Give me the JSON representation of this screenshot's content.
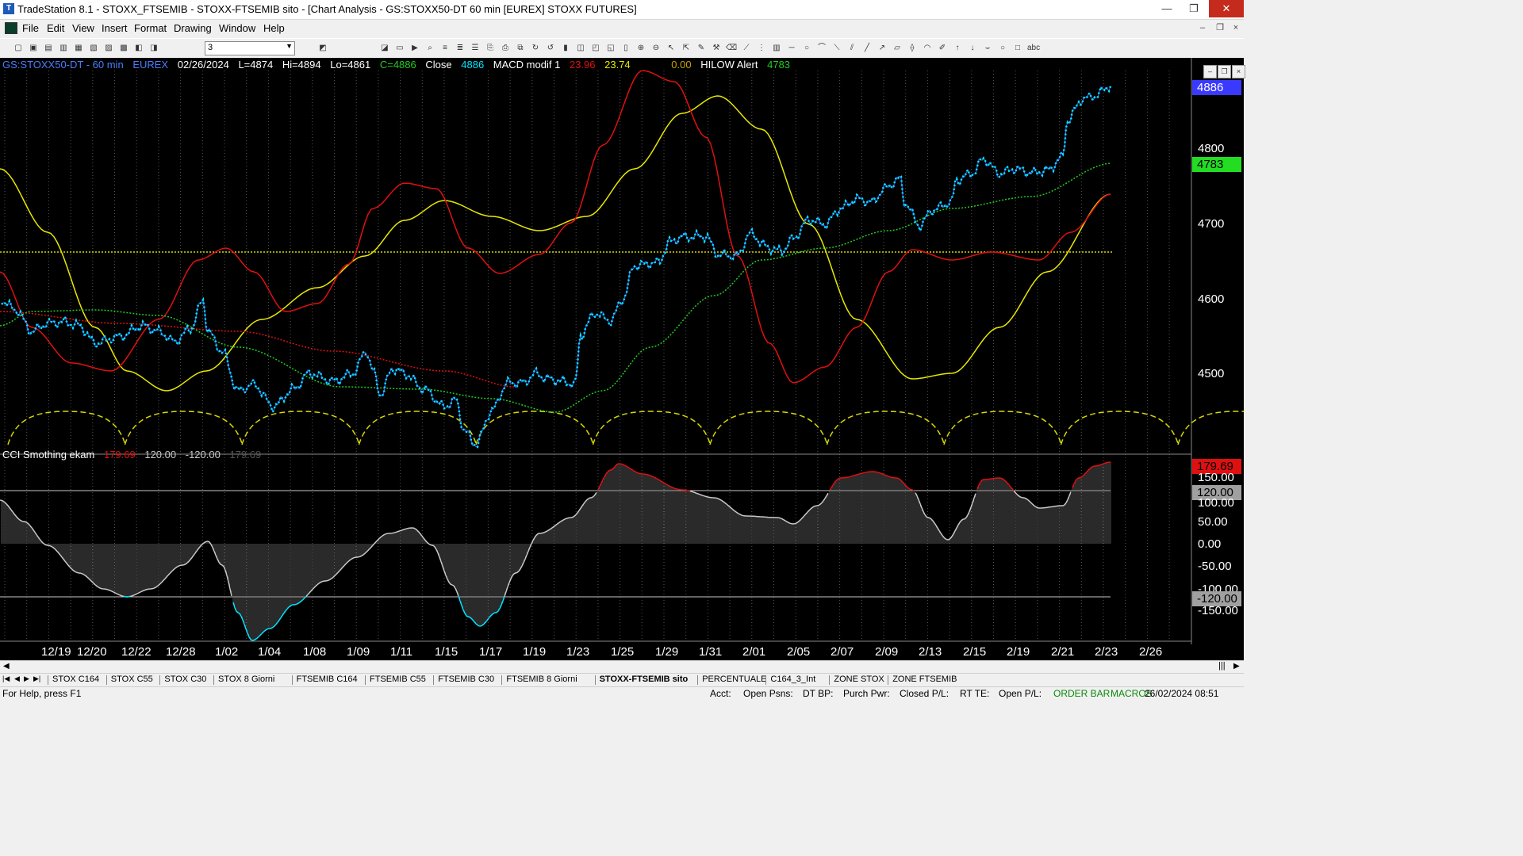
{
  "window": {
    "title": "TradeStation 8.1 - STOXX_FTSEMIB - STOXX-FTSEMIB sito - [Chart Analysis - GS:STOXX50-DT  60 min  [EUREX] STOXX FUTURES]",
    "minimize": "—",
    "maximize": "❐",
    "close": "✕"
  },
  "menu": [
    "File",
    "Edit",
    "View",
    "Insert",
    "Format",
    "Drawing",
    "Window",
    "Help"
  ],
  "mdi_buttons": [
    "–",
    "❐",
    "×"
  ],
  "toolbar": {
    "combo_value": "3",
    "icons": [
      "new-doc-icon",
      "open-icon",
      "open-workspace-icon",
      "print-preview-icon",
      "save-icon",
      "print-icon",
      "printer-setup-icon",
      "copy-icon",
      "paste-icon",
      "lock-icon",
      "apps-icon",
      "network-icon",
      "workspace-list-icon",
      "play-icon",
      "binoculars-icon",
      "format-a-icon",
      "format-b-icon",
      "format-c-icon",
      "link-a-icon",
      "link-b-icon",
      "link-c-icon",
      "refresh-a-icon",
      "refresh-b-icon",
      "bar-chart-icon",
      "chart-a-icon",
      "chart-b-icon",
      "chart-c-icon",
      "bars-icon",
      "zoom-in-icon",
      "zoom-out-icon",
      "pointer-icon",
      "select-cursor-icon",
      "tools-icon",
      "format-drawing-icon",
      "erase-icon",
      "trendline-icon",
      "fib-icon",
      "bars-lines-icon",
      "horizontal-line-icon",
      "cycle-icon",
      "gann-icon",
      "speed-line-icon",
      "andrews-icon",
      "line-icon",
      "arrow-icon",
      "channel-icon",
      "fan-icon",
      "arc-icon",
      "pencil-icon",
      "arrow-up-icon",
      "arrow-down-icon",
      "curve-icon",
      "circle-icon",
      "rectangle-icon",
      "text-abc-icon"
    ]
  },
  "chart": {
    "symbol": "GS:STOXX50-DT - 60 min",
    "exchange": "EUREX",
    "date": "02/26/2024",
    "last": "L=4874",
    "high": "Hi=4894",
    "low": "Lo=4861",
    "close_val": "C=4886",
    "close_label": "Close",
    "close_num": "4886",
    "macd_name": "MACD modif 1",
    "macd_v1": "23.96",
    "macd_v2": "23.74",
    "macd_v3": "0.00",
    "hilow_name": "HILOW Alert",
    "hilow_val": "4783",
    "price_axis": [
      "4800",
      "4700",
      "4600",
      "4500"
    ],
    "price_box_close": "4886",
    "price_box_hilow": "4783",
    "cci_name": "CCI Smothing ekam",
    "cci_v1": "179.69",
    "cci_v2": "120.00",
    "cci_v3": "-120.00",
    "cci_v4": "179.69",
    "cci_axis": [
      "150.00",
      "100.00",
      "50.00",
      "0.00",
      "-50.00",
      "-100.00",
      "-150.00"
    ],
    "cci_box_high": "179.69",
    "cci_box_ob": "120.00",
    "cci_box_os": "-120.00",
    "dates": [
      "12/19",
      "12/20",
      "12/22",
      "12/28",
      "1/02",
      "1/04",
      "1/08",
      "1/09",
      "1/11",
      "1/15",
      "1/17",
      "1/19",
      "1/23",
      "1/25",
      "1/29",
      "1/31",
      "2/01",
      "2/05",
      "2/07",
      "2/09",
      "2/13",
      "2/15",
      "2/19",
      "2/21",
      "2/23",
      "2/26"
    ],
    "colors": {
      "price": "#00e5ff",
      "price_line": "#4060ff",
      "macd_red": "#e01010",
      "macd_yellow": "#e8e800",
      "hilow_green": "#22cc22",
      "cycle_yellow": "#d8d800",
      "cci_up": "#e01010",
      "cci_mid": "#c8c8c8",
      "cci_down": "#00e5ff"
    }
  },
  "tabs": [
    "STOX C164",
    "STOX C55",
    "STOX C30",
    "STOX 8 Giorni",
    "FTSEMIB C164",
    "FTSEMIB C55",
    "FTSEMIB C30",
    "FTSEMIB 8 Giorni",
    "STOXX-FTSEMIB sito",
    "PERCENTUALE",
    "C164_3_Int",
    "ZONE STOX",
    "ZONE FTSEMIB"
  ],
  "active_tab": "STOXX-FTSEMIB sito",
  "statusbar": {
    "help": "For Help, press F1",
    "acct": "Acct:",
    "open_psns": "Open Psns:",
    "dt_bp": "DT BP:",
    "purch_pwr": "Purch Pwr:",
    "closed_pl": "Closed P/L:",
    "rt_te": "RT TE:",
    "open_pl": "Open P/L:",
    "order_bar": "ORDER BAR",
    "macros": "MACROS",
    "datetime": "26/02/2024 08:51"
  }
}
